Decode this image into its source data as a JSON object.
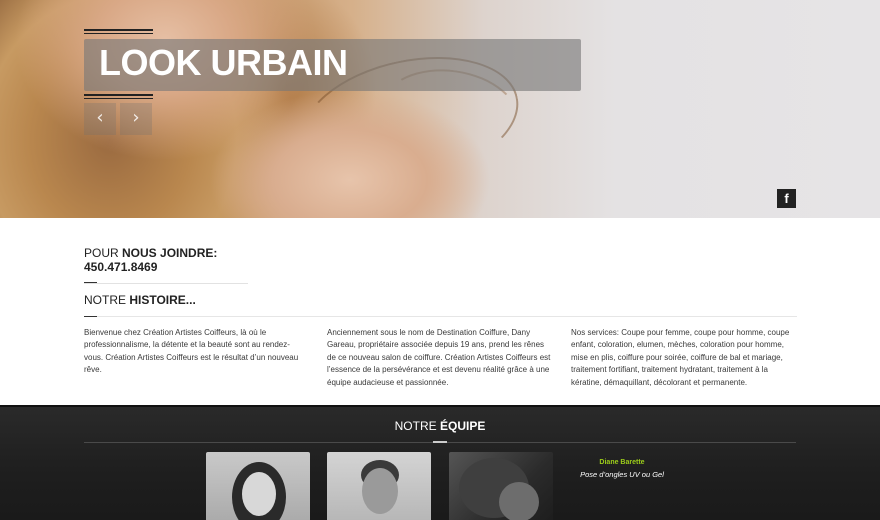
{
  "hero": {
    "title": "LOOK URBAIN",
    "prev_glyph": "‹",
    "next_glyph": "›",
    "facebook_glyph": "f"
  },
  "contact": {
    "prefix": "POUR ",
    "bold": "NOUS JOINDRE:",
    "phone": "450.471.8469"
  },
  "story": {
    "prefix": "NOTRE ",
    "bold": "HISTOIRE...",
    "columns": [
      "Bienvenue chez Création Artistes Coiffeurs, là où le professionnalisme, la détente et la beauté sont au rendez-vous. Création Artistes Coiffeurs est le résultat d’un nouveau rêve.",
      "Anciennement sous le nom de Destination Coiffure, Dany Gareau, propriétaire associée depuis 19 ans, prend les rênes de ce nouveau salon de coiffure. Création Artistes Coiffeurs est l’essence de la persévérance et est devenu réalité grâce à une équipe audacieuse et passionnée.",
      "Nos services: Coupe pour femme, coupe pour homme, coupe enfant, coloration, elumen, mèches, coloration pour homme, mise en plis, coiffure pour soirée, coiffure de bal et mariage, traitement fortifiant, traitement hydratant, traitement à la kératine, démaquillant, décolorant et permanente."
    ]
  },
  "team": {
    "prefix": "NOTRE ",
    "bold": "ÉQUIPE",
    "featured_member": {
      "name": "Diane Barette",
      "role": "Pose d’ongles UV ou Gel"
    }
  },
  "colors": {
    "accent_green": "#9ccc1a",
    "team_bg": "#1e1e1e",
    "title_overlay": "#787878"
  }
}
